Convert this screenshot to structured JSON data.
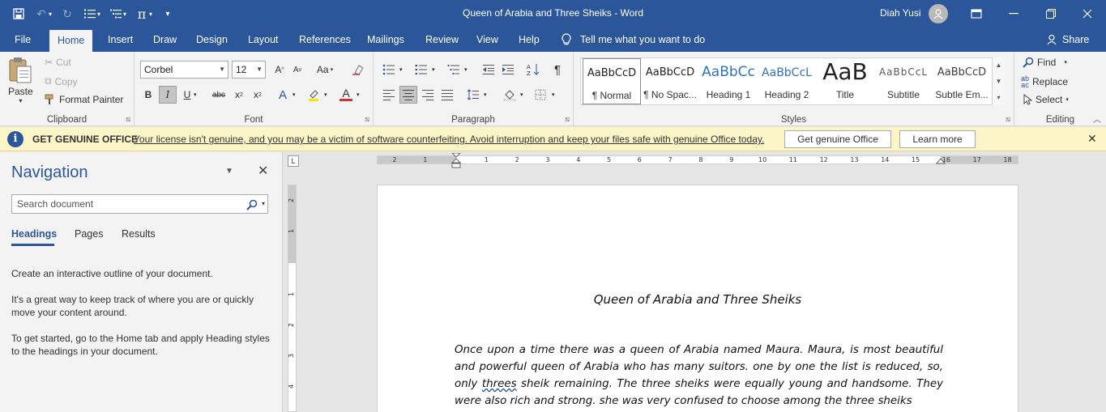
{
  "window": {
    "title": "Queen of Arabia and Three Sheiks  -  Word",
    "user": "Diah Yusi"
  },
  "tabs": [
    "File",
    "Home",
    "Insert",
    "Draw",
    "Design",
    "Layout",
    "References",
    "Mailings",
    "Review",
    "View",
    "Help"
  ],
  "tell_me": "Tell me what you want to do",
  "share": "Share",
  "ribbon": {
    "clipboard": {
      "label": "Clipboard",
      "paste": "Paste",
      "cut": "Cut",
      "copy": "Copy",
      "format_painter": "Format Painter"
    },
    "font": {
      "label": "Font",
      "font_name": "Corbel",
      "font_size": "12",
      "change_case": "Aa"
    },
    "paragraph": {
      "label": "Paragraph"
    },
    "styles": {
      "label": "Styles",
      "items": [
        {
          "preview": "AaBbCcD",
          "name": "¶ Normal"
        },
        {
          "preview": "AaBbCcD",
          "name": "¶ No Spac..."
        },
        {
          "preview": "AaBbCc",
          "name": "Heading 1"
        },
        {
          "preview": "AaBbCcL",
          "name": "Heading 2"
        },
        {
          "preview": "AaB",
          "name": "Title"
        },
        {
          "preview": "AaBbCcL",
          "name": "Subtitle"
        },
        {
          "preview": "AaBbCcD",
          "name": "Subtle Em..."
        }
      ]
    },
    "editing": {
      "label": "Editing",
      "find": "Find",
      "replace": "Replace",
      "select": "Select"
    }
  },
  "infobar": {
    "title": "GET GENUINE OFFICE",
    "message": "Your license isn't genuine, and you may be a victim of software counterfeiting. Avoid interruption and keep your files safe with genuine Office today.",
    "btn_genuine": "Get genuine Office",
    "btn_learn": "Learn more"
  },
  "navigation": {
    "title": "Navigation",
    "search_placeholder": "Search document",
    "tabs": [
      "Headings",
      "Pages",
      "Results"
    ],
    "text1": "Create an interactive outline of your document.",
    "text2": "It's a great way to keep track of where you are or quickly move your content around.",
    "text3": "To get started, go to the Home tab and apply Heading styles to the headings in your document."
  },
  "ruler": {
    "h_left": [
      "2",
      "1"
    ],
    "h_right": [
      "1",
      "2",
      "3",
      "4",
      "5",
      "6",
      "7",
      "8",
      "9",
      "10",
      "11",
      "12",
      "13",
      "14",
      "15",
      "16",
      "17",
      "18"
    ],
    "v": [
      "2",
      "1",
      "1",
      "2",
      "3",
      "4"
    ]
  },
  "document": {
    "heading": "Queen of Arabia and Three Sheiks",
    "para_before": "Once upon a time there was a queen of Arabia named Maura. Maura, is most beautiful and powerful queen of Arabia who has many suitors. one by one the list is reduced, so, only ",
    "para_flag": "threes",
    "para_after": " sheik remaining. The three sheiks were equally young and handsome. They were also rich and strong. she was very confused to choose among the three sheiks"
  },
  "colors": {
    "accent": "#2b579a",
    "infobar_bg": "#fcf5c8"
  }
}
